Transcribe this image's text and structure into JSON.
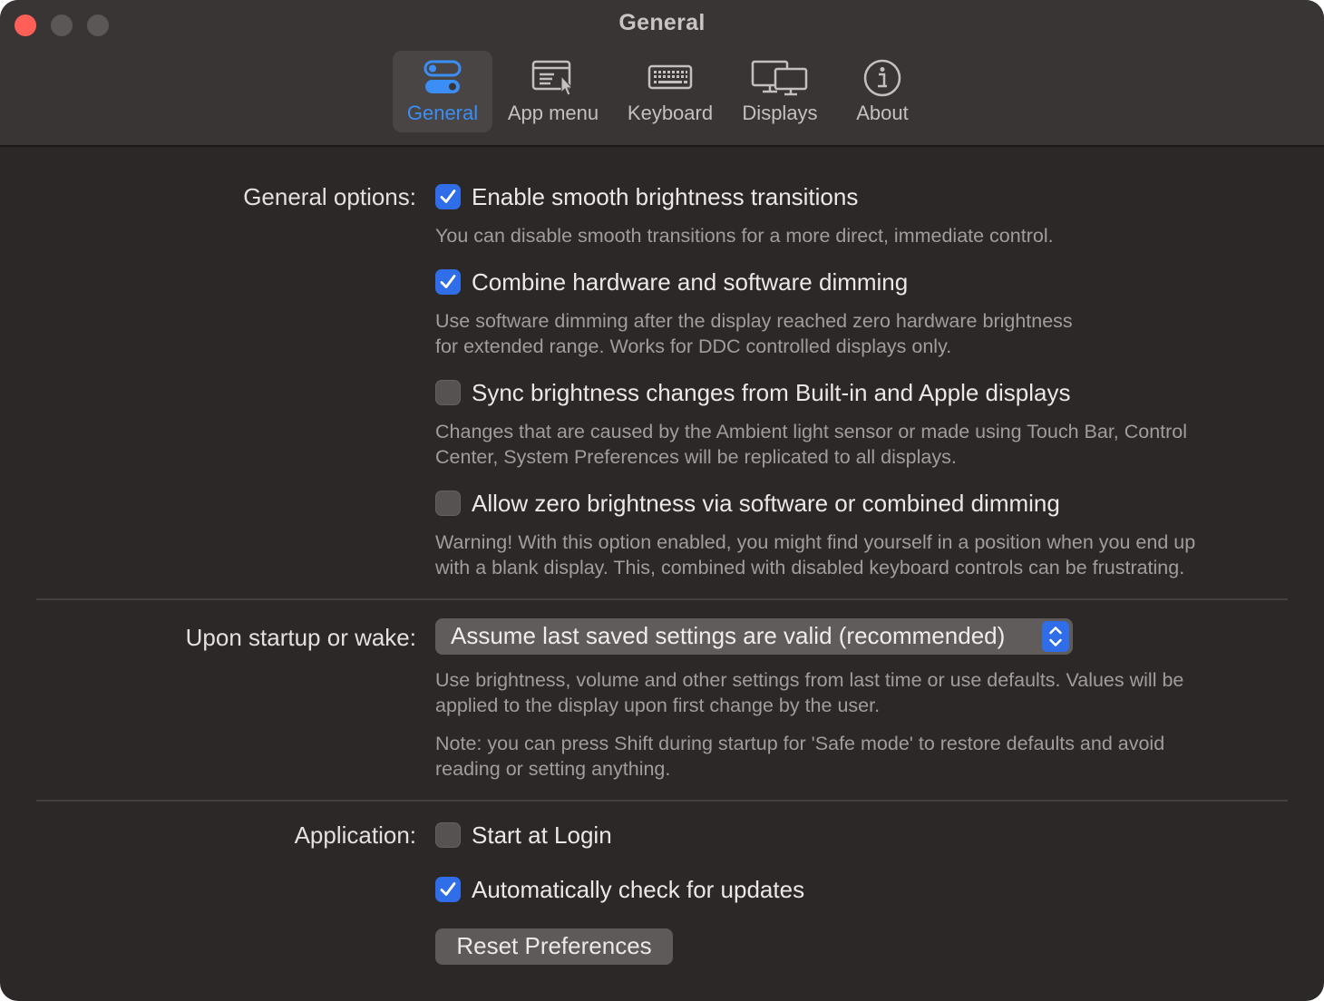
{
  "window": {
    "title": "General"
  },
  "toolbar": {
    "tabs": [
      {
        "label": "General",
        "icon": "toggles-icon",
        "active": true
      },
      {
        "label": "App menu",
        "icon": "app-menu-icon",
        "active": false
      },
      {
        "label": "Keyboard",
        "icon": "keyboard-icon",
        "active": false
      },
      {
        "label": "Displays",
        "icon": "displays-icon",
        "active": false
      },
      {
        "label": "About",
        "icon": "info-icon",
        "active": false
      }
    ]
  },
  "general_options": {
    "label": "General options:",
    "items": [
      {
        "label": "Enable smooth brightness transitions",
        "checked": true,
        "description": "You can disable smooth transitions for a more direct, immediate control."
      },
      {
        "label": "Combine hardware and software dimming",
        "checked": true,
        "description_lines": [
          "Use software dimming after the display reached zero hardware brightness",
          "for extended range. Works for DDC controlled displays only."
        ]
      },
      {
        "label": "Sync brightness changes from Built-in and Apple displays",
        "checked": false,
        "description_lines": [
          "Changes that are caused by the Ambient light sensor or made using Touch Bar, Control",
          "Center, System Preferences will be replicated to all displays."
        ]
      },
      {
        "label": "Allow zero brightness via software or combined dimming",
        "checked": false,
        "description_lines": [
          "Warning! With this option enabled, you might find yourself in a position when you end up",
          "with a blank display. This, combined with disabled keyboard controls can be frustrating."
        ]
      }
    ]
  },
  "startup": {
    "label": "Upon startup or wake:",
    "selected": "Assume last saved settings are valid (recommended)",
    "description_lines": [
      "Use brightness, volume and other settings from last time or use defaults. Values will be",
      "applied to the display upon first change by the user."
    ],
    "note_lines": [
      "Note: you can press Shift during startup for 'Safe mode' to restore defaults and avoid",
      "reading or setting anything."
    ]
  },
  "application": {
    "label": "Application:",
    "items": [
      {
        "label": "Start at Login",
        "checked": false
      },
      {
        "label": "Automatically check for updates",
        "checked": true
      }
    ],
    "reset_button": "Reset Preferences"
  },
  "colors": {
    "accent": "#3b8ef5",
    "checkbox_on": "#2f6ee8",
    "close_button": "#ff5f57",
    "background": "#2c2828",
    "toolbar": "#3a3535"
  }
}
